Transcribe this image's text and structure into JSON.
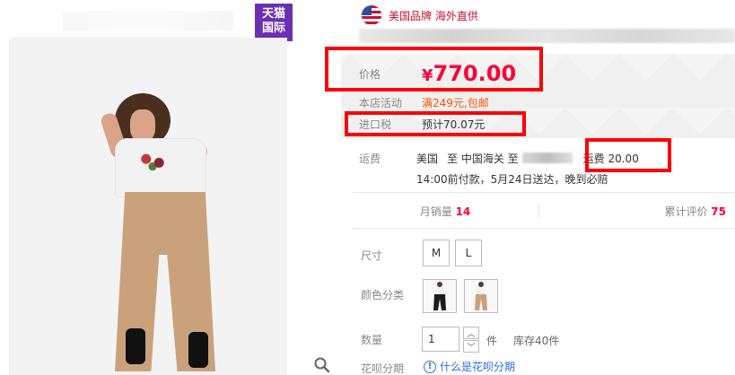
{
  "badge": {
    "line1": "天猫",
    "line2": "国际"
  },
  "brand": {
    "text": "美国品牌 海外直供"
  },
  "price": {
    "label": "价格",
    "currency": "¥",
    "value": "770.00"
  },
  "promo": {
    "label": "本店活动",
    "value": "满249元,包邮"
  },
  "tax": {
    "label": "进口税",
    "value": "预计70.07元"
  },
  "shipping": {
    "label": "运费",
    "route_from": "美国",
    "route_mid": "至 中国海关 至",
    "fee": "运费 20.00",
    "note": "14:00前付款，5月24日送达，晚到必赔"
  },
  "stats": {
    "monthly_label": "月销量",
    "monthly_value": "14",
    "reviews_label": "累计评价",
    "reviews_value": "75"
  },
  "options": {
    "size_label": "尺寸",
    "sizes": [
      "M",
      "L"
    ],
    "color_label": "颜色分类"
  },
  "quantity": {
    "label": "数量",
    "value": "1",
    "unit": "件",
    "stock": "库存40件"
  },
  "installment": {
    "label": "花呗分期",
    "link": "什么是花呗分期"
  },
  "colors": {
    "accent": "#ff0036",
    "promo": "#ff5200",
    "badge": "#6b2fb2",
    "highlight_box": "#ff0000"
  }
}
